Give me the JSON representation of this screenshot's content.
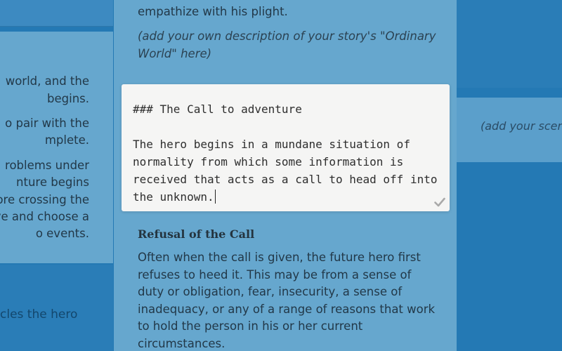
{
  "left": {
    "lines": [
      "world, and the",
      "begins.",
      "o pair with the",
      "mplete.",
      "roblems under",
      "nture begins",
      "ore crossing the",
      "ve and choose a",
      "o events."
    ],
    "bottom_text": "cles the hero"
  },
  "center": {
    "intro_tail": "empathize with his plight.",
    "ordinary_world_note": "(add your own description of your story's \"Ordinary World\" here)",
    "refusal_title": "Refusal of the Call",
    "refusal_body": "Often when the call is given, the future hero first refuses to heed it. This may be from a sense of duty or obligation, fear, insecurity, a sense of inadequacy, or any of a range of reasons that work to hold the person in his or her current circumstances."
  },
  "right": {
    "scene_note": "(add your scen"
  },
  "editor": {
    "heading_line": "### The Call to adventure",
    "body": "The hero begins in a mundane situation of normality from which some information is received that acts as a call to head off into the unknown.",
    "check_icon": "checkmark-icon"
  },
  "colors": {
    "background": "#2479b4",
    "card": "#66a7ce",
    "editor": "#f5f5f4",
    "text": "#223848"
  }
}
